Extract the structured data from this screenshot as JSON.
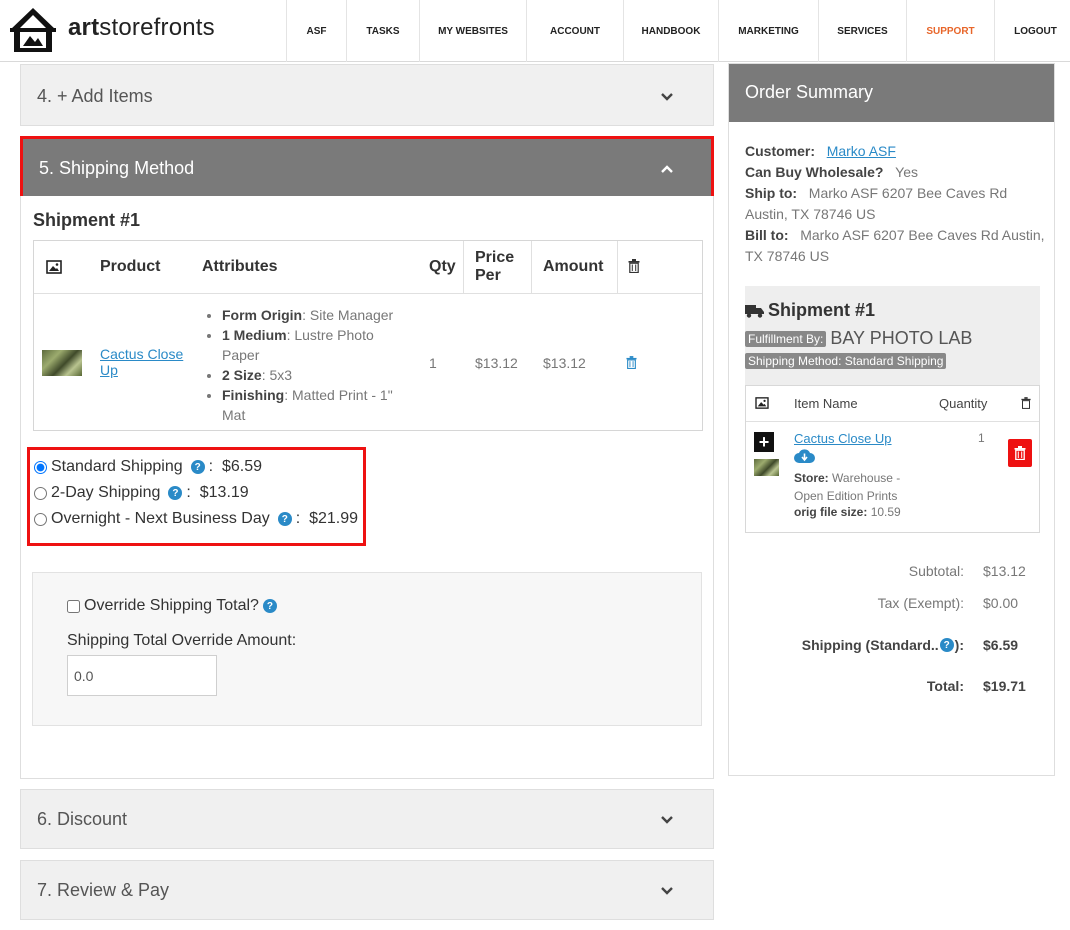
{
  "brand": {
    "name_bold": "art",
    "name_rest": "storefronts"
  },
  "nav": [
    {
      "label": "ASF"
    },
    {
      "label": "TASKS"
    },
    {
      "label": "MY WEBSITES"
    },
    {
      "label": "ACCOUNT"
    },
    {
      "label": "HANDBOOK"
    },
    {
      "label": "MARKETING"
    },
    {
      "label": "SERVICES"
    },
    {
      "label": "SUPPORT"
    },
    {
      "label": "LOGOUT"
    }
  ],
  "steps": {
    "add_items": "4. + Add Items",
    "shipping_method": "5. Shipping Method",
    "discount": "6. Discount",
    "review_pay": "7. Review & Pay"
  },
  "shipment": {
    "title": "Shipment #1",
    "columns": {
      "product": "Product",
      "attributes": "Attributes",
      "qty": "Qty",
      "price_per": "Price Per",
      "amount": "Amount"
    },
    "row": {
      "product": "Cactus Close Up",
      "attributes": [
        {
          "key": "Form Origin",
          "value": ": Site Manager"
        },
        {
          "key": "1 Medium",
          "value": ": Lustre Photo Paper"
        },
        {
          "key": "2 Size",
          "value": ": 5x3"
        },
        {
          "key": "Finishing",
          "value": ": Matted Print - 1\" Mat"
        }
      ],
      "qty": "1",
      "price_per": "$13.12",
      "amount": "$13.12"
    }
  },
  "shipping_options": [
    {
      "label": "Standard Shipping",
      "price": "$6.59",
      "selected": true
    },
    {
      "label": "2-Day Shipping",
      "price": "$13.19",
      "selected": false
    },
    {
      "label": "Overnight - Next Business Day",
      "price": "$21.99",
      "selected": false
    }
  ],
  "override": {
    "checkbox_label": "Override Shipping Total?",
    "amount_label": "Shipping Total Override Amount:",
    "amount_value": "0.0"
  },
  "summary": {
    "title": "Order Summary",
    "customer_label": "Customer:",
    "customer_name": "Marko ASF",
    "wholesale_label": "Can Buy Wholesale?",
    "wholesale_value": "Yes",
    "ship_to_label": "Ship to:",
    "ship_to_value": "Marko ASF 6207 Bee Caves Rd Austin, TX 78746 US",
    "bill_to_label": "Bill to:",
    "bill_to_value": "Marko ASF 6207 Bee Caves Rd Austin, TX 78746 US",
    "shipment_title": "Shipment #1",
    "fulfillment_tag": "Fulfillment By:",
    "fulfillment_lab": "BAY PHOTO LAB",
    "shipping_method_tag": "Shipping Method: Standard Shipping",
    "item_name_header": "Item Name",
    "quantity_header": "Quantity",
    "item_name": "Cactus Close Up",
    "item_qty": "1",
    "store_label": "Store:",
    "store_value": "Warehouse - Open Edition Prints",
    "orig_label": "orig file size:",
    "orig_value": "10.59",
    "subtotal_label": "Subtotal:",
    "subtotal_value": "$13.12",
    "tax_label": "Tax (Exempt):",
    "tax_value": "$0.00",
    "shipping_label": "Shipping (Standard..",
    "shipping_value": "$6.59",
    "total_label": "Total:",
    "total_value": "$19.71"
  },
  "colors": {
    "accent_red": "#ee1111",
    "link_blue": "#2a8ac7",
    "header_gray": "#7a7a7a",
    "support_orange": "#e8662a"
  }
}
